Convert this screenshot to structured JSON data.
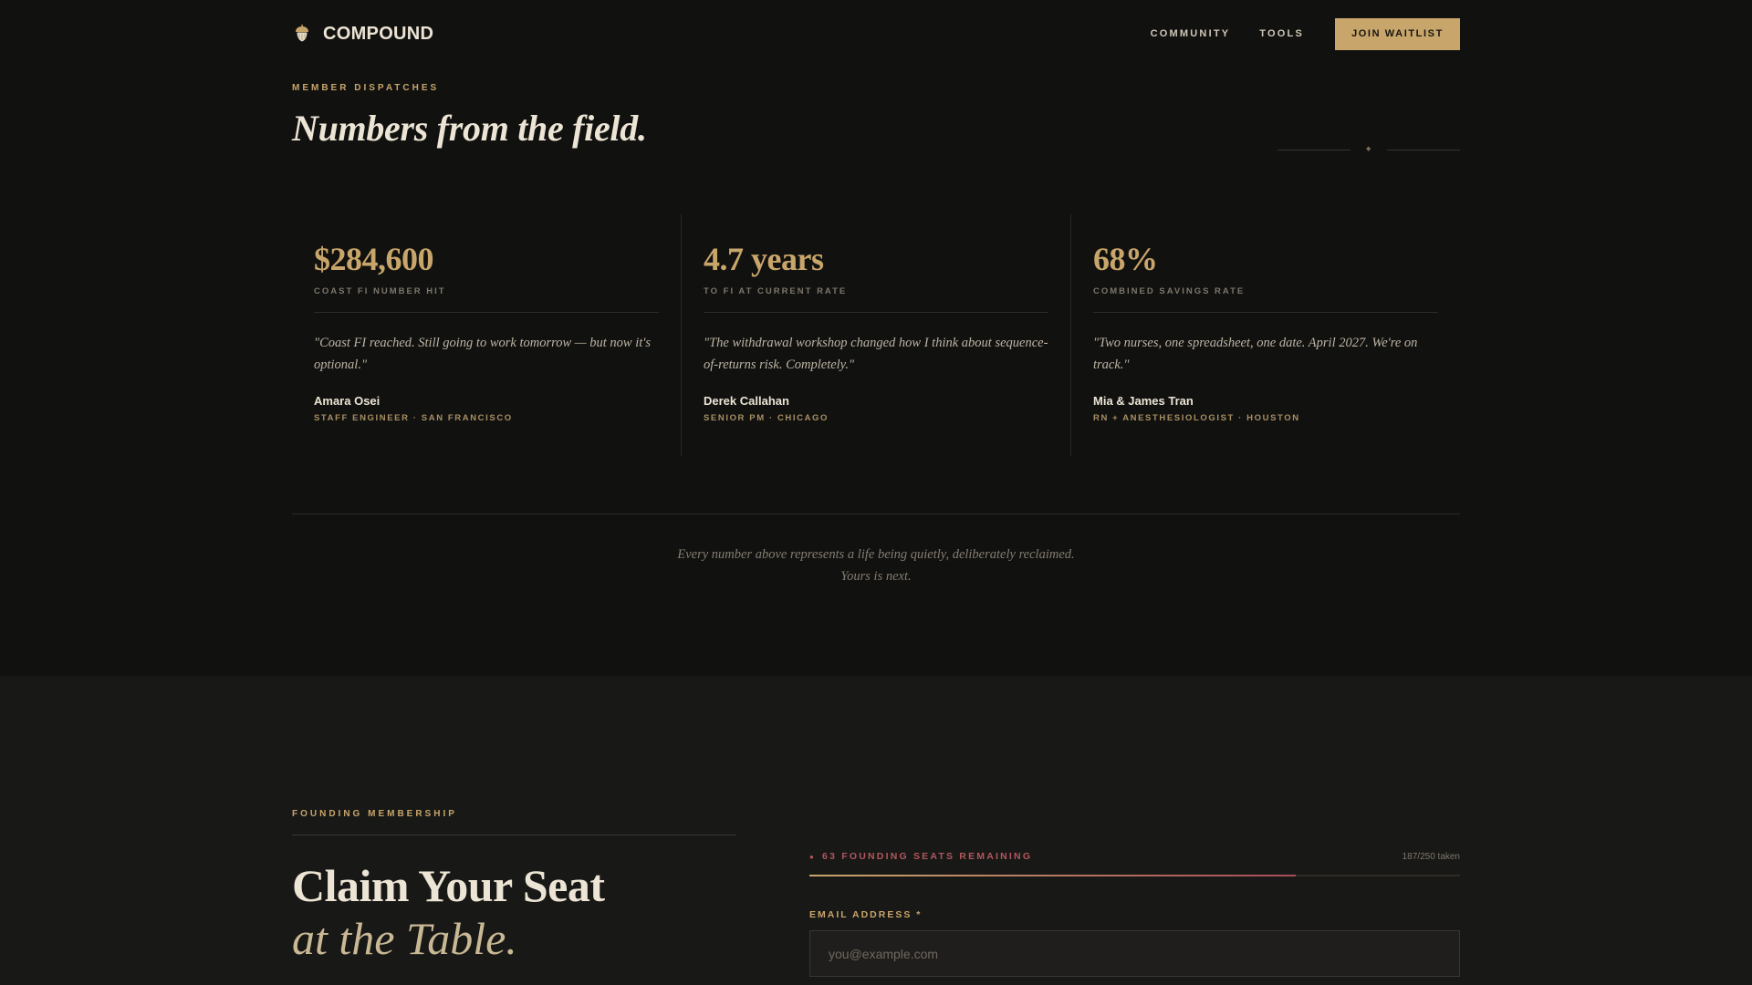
{
  "header": {
    "brand": "COMPOUND",
    "brand_icon": "acorn-icon",
    "nav": [
      "COMMUNITY",
      "TOOLS"
    ],
    "cta": "JOIN WAITLIST"
  },
  "dispatches": {
    "eyebrow": "MEMBER DISPATCHES",
    "title": "Numbers from the field.",
    "cards": [
      {
        "stat": "$284,600",
        "label": "COAST FI NUMBER HIT",
        "quote": "\"Coast FI reached. Still going to work tomorrow — but now it's optional.\"",
        "name": "Amara Osei",
        "role": "STAFF ENGINEER · SAN FRANCISCO"
      },
      {
        "stat": "4.7 years",
        "label": "TO FI AT CURRENT RATE",
        "quote": "\"The withdrawal workshop changed how I think about sequence-of-returns risk. Completely.\"",
        "name": "Derek Callahan",
        "role": "SENIOR PM · CHICAGO"
      },
      {
        "stat": "68%",
        "label": "COMBINED SAVINGS RATE",
        "quote": "\"Two nurses, one spreadsheet, one date. April 2027. We're on track.\"",
        "name": "Mia & James Tran",
        "role": "RN + ANESTHESIOLOGIST · HOUSTON"
      }
    ],
    "closing_line1": "Every number above represents a life being quietly, deliberately reclaimed.",
    "closing_line2": "Yours is next."
  },
  "founding": {
    "eyebrow": "FOUNDING MEMBERSHIP",
    "title": "Claim Your Seat",
    "subtitle": "at the Table.",
    "seats_text": "63 FOUNDING SEATS REMAINING",
    "taken_text": "187/250 taken",
    "progress": 0.748,
    "email_label": "EMAIL ADDRESS *",
    "email_placeholder": "you@example.com",
    "email_value": ""
  },
  "colors": {
    "background": "#111110",
    "accent": "#c8a56a",
    "alert": "#b2575c"
  }
}
